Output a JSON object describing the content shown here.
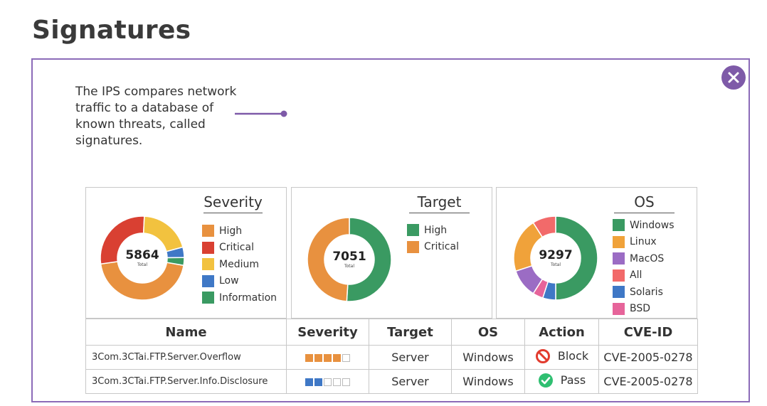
{
  "page_title": "Signatures",
  "intro_text": "The IPS compares network traffic to a database of known threats, called signatures.",
  "colors": {
    "accent": "#7e5aa8",
    "high_orange": "#e8913f",
    "critical_red": "#d94032",
    "medium_yellow": "#f2c23f",
    "low_blue": "#3f78c6",
    "info_green": "#3a9a62",
    "windows_green": "#3a9a62",
    "linux_orange": "#f0a23a",
    "macos_purple": "#9b6cc4",
    "all_pink": "#f26a6a",
    "solaris_blue": "#3f78c6",
    "bsd_pink": "#e6649a"
  },
  "charts": {
    "severity": {
      "title": "Severity",
      "total": "5864",
      "total_label": "Total",
      "legend": [
        "High",
        "Critical",
        "Medium",
        "Low",
        "Information"
      ]
    },
    "target": {
      "title": "Target",
      "total": "7051",
      "total_label": "Total",
      "legend": [
        "High",
        "Critical"
      ]
    },
    "os": {
      "title": "OS",
      "total": "9297",
      "total_label": "Total",
      "legend": [
        "Windows",
        "Linux",
        "MacOS",
        "All",
        "Solaris",
        "BSD"
      ]
    }
  },
  "chart_data": [
    {
      "type": "pie",
      "title": "Severity",
      "categories": [
        "High",
        "Critical",
        "Medium",
        "Low",
        "Information"
      ],
      "values": [
        45,
        28,
        20,
        4,
        3
      ],
      "unit": "percent (estimated)",
      "total": 5864
    },
    {
      "type": "pie",
      "title": "Target",
      "categories": [
        "High",
        "Critical"
      ],
      "values": [
        51,
        49
      ],
      "unit": "percent (estimated)",
      "total": 7051
    },
    {
      "type": "pie",
      "title": "OS",
      "categories": [
        "Windows",
        "Linux",
        "MacOS",
        "All",
        "Solaris",
        "BSD"
      ],
      "values": [
        50,
        21,
        11,
        9,
        5,
        4
      ],
      "unit": "percent (estimated)",
      "total": 9297
    }
  ],
  "table": {
    "headers": [
      "Name",
      "Severity",
      "Target",
      "OS",
      "Action",
      "CVE-ID"
    ],
    "rows": [
      {
        "name": "3Com.3CTai.FTP.Server.Overflow",
        "severity_level": 4,
        "severity_max": 5,
        "target": "Server",
        "os": "Windows",
        "action": "Block",
        "action_icon": "block-icon",
        "cve": "CVE-2005-0278"
      },
      {
        "name": "3Com.3CTai.FTP.Server.Info.Disclosure",
        "severity_level": 2,
        "severity_max": 5,
        "target": "Server",
        "os": "Windows",
        "action": "Pass",
        "action_icon": "check-icon",
        "cve": "CVE-2005-0278"
      }
    ]
  }
}
